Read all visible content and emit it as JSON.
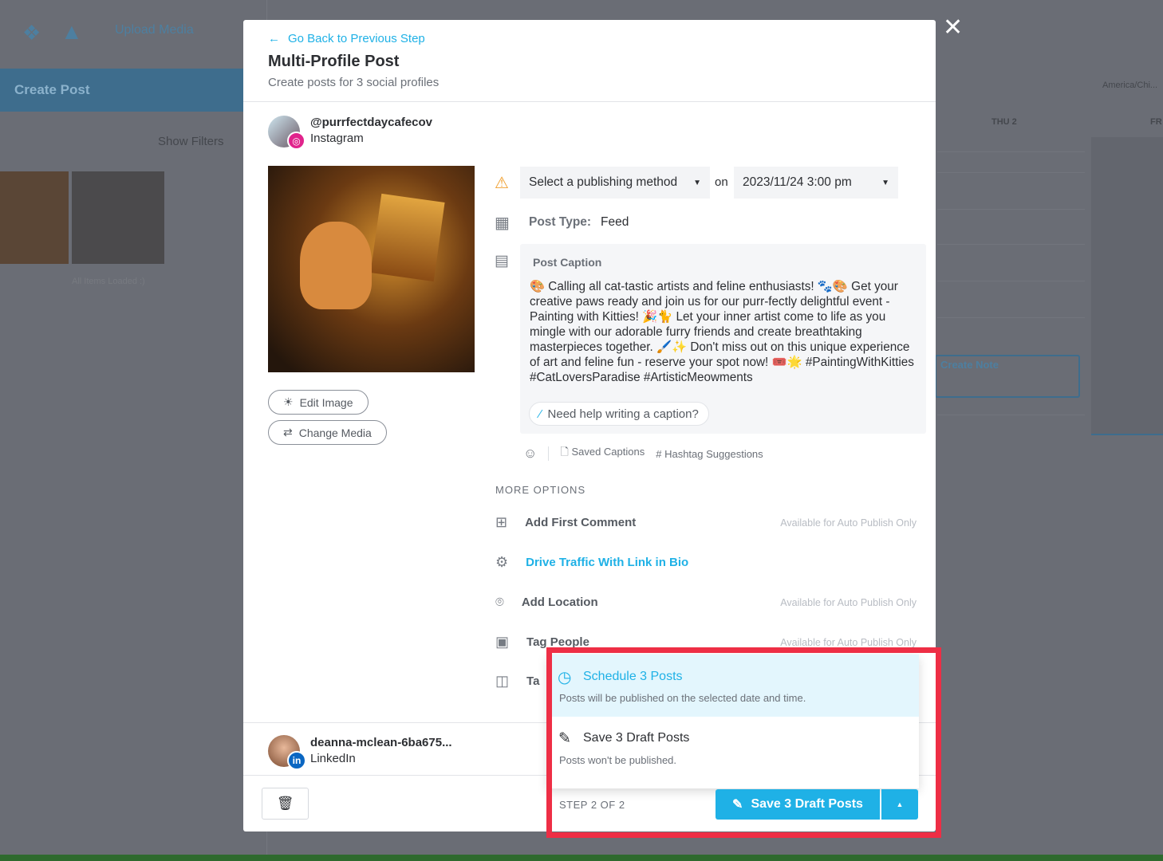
{
  "background": {
    "upload_media": "Upload Media",
    "create_post": "Create Post",
    "show_filters": "Show Filters",
    "all_items_loaded": "All Items Loaded :)",
    "timezone": "America/Chi...",
    "day_thu": "THU 2",
    "day_fri": "FR",
    "create_note": "Create Note"
  },
  "modal": {
    "back_link": "Go Back to Previous Step",
    "title": "Multi-Profile Post",
    "subtitle": "Create posts for 3 social profiles",
    "profile1": {
      "handle": "@purrfectdaycafecov",
      "network": "Instagram"
    },
    "edit_image": "Edit Image",
    "change_media": "Change Media",
    "publishing_method": "Select a publishing method",
    "on": "on",
    "datetime": "2023/11/24 3:00 pm",
    "post_type_label": "Post Type:",
    "post_type_value": "Feed",
    "caption_label": "Post Caption",
    "caption": "🎨 Calling all cat-tastic artists and feline enthusiasts! 🐾🎨 Get your creative paws ready and join us for our purr-fectly delightful event - Painting with Kitties! 🎉🐈 Let your inner artist come to life as you mingle with our adorable furry friends and create breathtaking masterpieces together. 🖌️✨ Don't miss out on this unique experience of art and feline fun - reserve your spot now! 🎟️🌟 #PaintingWithKitties #CatLoversParadise #ArtisticMeowments",
    "caption_help": "Need help writing a caption?",
    "saved_captions": "Saved Captions",
    "hashtag_suggestions": "Hashtag Suggestions",
    "more_options": "MORE OPTIONS",
    "options": [
      {
        "label": "Add First Comment",
        "note": "Available for Auto Publish Only"
      },
      {
        "label": "Drive Traffic With Link in Bio",
        "note": ""
      },
      {
        "label": "Add Location",
        "note": "Available for Auto Publish Only"
      },
      {
        "label": "Tag People",
        "note": "Available for Auto Publish Only"
      },
      {
        "label": "Ta",
        "note": ""
      }
    ],
    "profile2": {
      "handle": "deanna-mclean-6ba675...",
      "network": "LinkedIn"
    },
    "step": "STEP 2 OF 2",
    "save_button": "Save 3 Draft Posts",
    "dropdown": [
      {
        "title": "Schedule 3 Posts",
        "desc": "Posts will be published on the selected date and time."
      },
      {
        "title": "Save 3 Draft Posts",
        "desc": "Posts won't be published."
      }
    ]
  },
  "colors": {
    "accent": "#1fb1e6",
    "highlight": "#e3f6fd",
    "annotation": "#ee2e45",
    "warning": "#f0a030"
  }
}
